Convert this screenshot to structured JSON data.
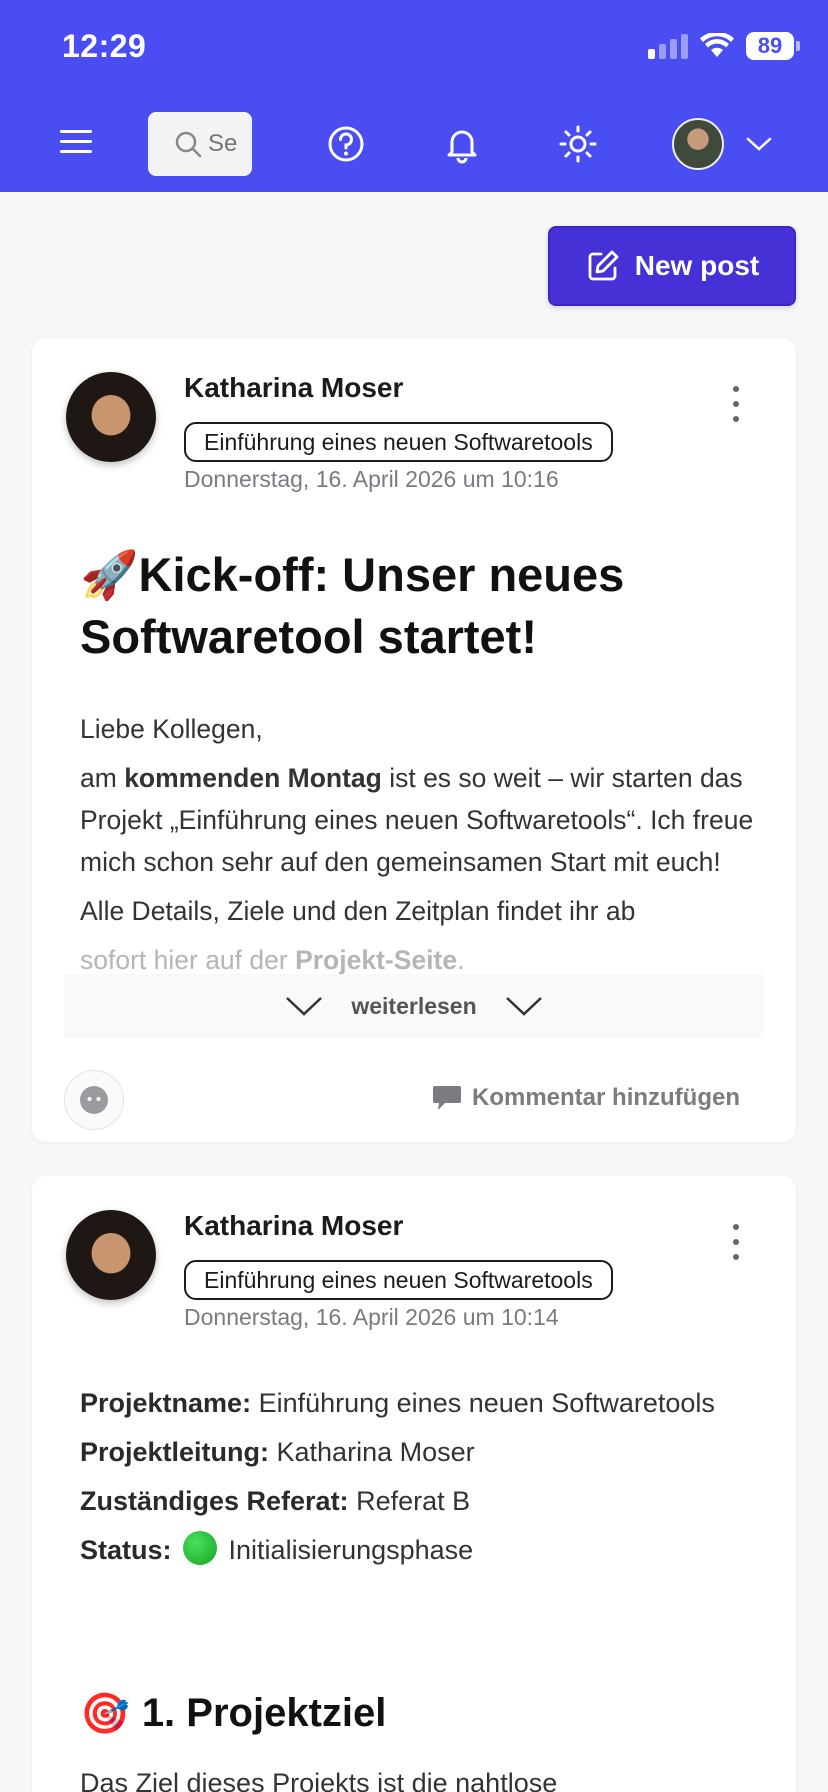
{
  "status_bar": {
    "time": "12:29",
    "battery": "89"
  },
  "header": {
    "search_placeholder": "Search"
  },
  "actions": {
    "new_post_label": "New post"
  },
  "posts": [
    {
      "author": "Katharina Moser",
      "topic": "Einführung eines neuen Softwaretools",
      "date": "Donnerstag, 16. April 2026 um 10:16",
      "title_emoji": "🚀",
      "title": "Kick-off: Unser neues Softwaretool startet!",
      "greeting": "Liebe Kollegen,",
      "p1_pre": "am ",
      "p1_bold": "kommenden Montag",
      "p1_post": " ist es so weit – wir starten das Projekt „Einführung eines neuen Softwaretools“. Ich freue mich schon sehr auf den gemeinsamen Start mit euch!",
      "p2": "Alle Details, Ziele und den Zeitplan findet ihr ab",
      "p3_pre": "sofort hier auf der ",
      "p3_bold": "Projekt-Seite",
      "p3_post": ".",
      "read_more": "weiterlesen",
      "comment_label": "Kommentar hinzufügen"
    },
    {
      "author": "Katharina Moser",
      "topic": "Einführung eines neuen Softwaretools",
      "date": "Donnerstag, 16. April 2026 um 10:14",
      "project_name_label": "Projektname:",
      "project_name": " Einführung eines neuen Softwaretools",
      "lead_label": "Projektleitung:",
      "lead": " Katharina Moser",
      "dept_label": "Zuständiges Referat:",
      "dept": " Referat B",
      "status_label": "Status:",
      "status": " Initialisierungsphase",
      "section_emoji": "🎯",
      "section_title": "1. Projektziel",
      "section_text": "Das Ziel dieses Projekts ist die nahtlose"
    }
  ],
  "colors": {
    "header_bg": "#4a4ef2",
    "button_bg": "#4631d6",
    "status_green": "#1fbf31"
  }
}
